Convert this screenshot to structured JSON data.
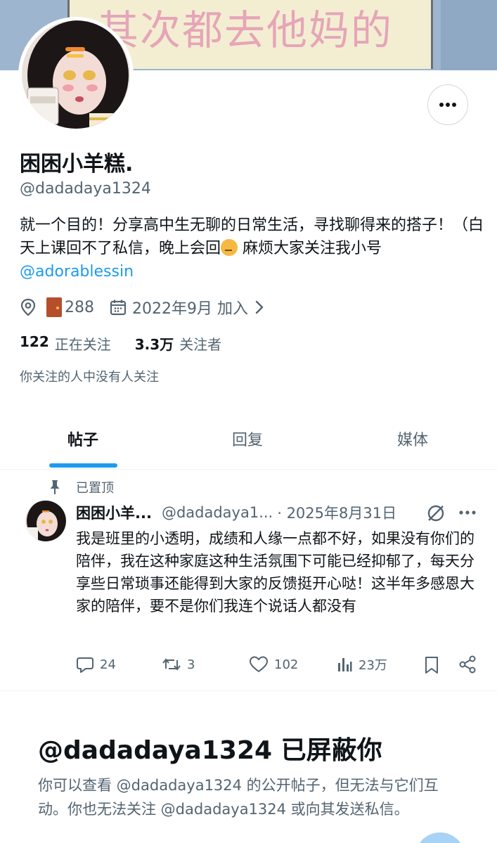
{
  "banner": {
    "text": "其次都去他妈的"
  },
  "profile": {
    "display_name": "困困小羊糕.",
    "handle": "@dadadaya1324",
    "bio_text": "就一个目的！分享高中生无聊的日常生活，寻找聊得来的搭子！（白天上课回不了私信，晚上会回",
    "bio_after_emoji": " 麻烦大家关注我小号",
    "bio_mention": "@adorablessin",
    "location_value": "288",
    "joined": "2022年9月 加入",
    "following_count": "122",
    "following_label": "正在关注",
    "followers_count": "3.3万",
    "followers_label": "关注者",
    "mutual_note": "你关注的人中没有人关注"
  },
  "tabs": [
    {
      "label": "帖子",
      "active": true
    },
    {
      "label": "回复",
      "active": false
    },
    {
      "label": "媒体",
      "active": false
    }
  ],
  "post": {
    "pinned_label": "已置顶",
    "author_name": "困困小羊...",
    "author_handle": "@dadadaya1...",
    "date": "· 2025年8月31日",
    "text": "我是班里的小透明，成绩和人缘一点都不好，如果没有你们的陪伴，我在这种家庭这种生活氛围下可能已经抑郁了，每天分享些日常琐事还能得到大家的反馈挺开心哒！这半年多感恩大家的陪伴，要不是你们我连个说话人都没有",
    "replies": "24",
    "reposts": "3",
    "likes": "102",
    "views": "23万"
  },
  "blocked": {
    "title": "@dadadaya1324 已屏蔽你",
    "description": "你可以查看 @dadadaya1324 的公开帖子，但无法与它们互动。你也无法关注 @dadadaya1324 或向其发送私信。"
  },
  "icons": {
    "more": "more-horizontal-icon",
    "location": "location-pin-icon",
    "door": "door-emoji-icon",
    "calendar": "calendar-icon",
    "pin": "pin-icon",
    "grok": "grok-icon",
    "reply": "reply-icon",
    "repost": "repost-icon",
    "like": "heart-icon",
    "views": "views-chart-icon",
    "bookmark": "bookmark-icon",
    "share": "share-icon"
  },
  "colors": {
    "accent": "#1d9bf0",
    "text_primary": "#0f1419",
    "text_secondary": "#536471"
  }
}
